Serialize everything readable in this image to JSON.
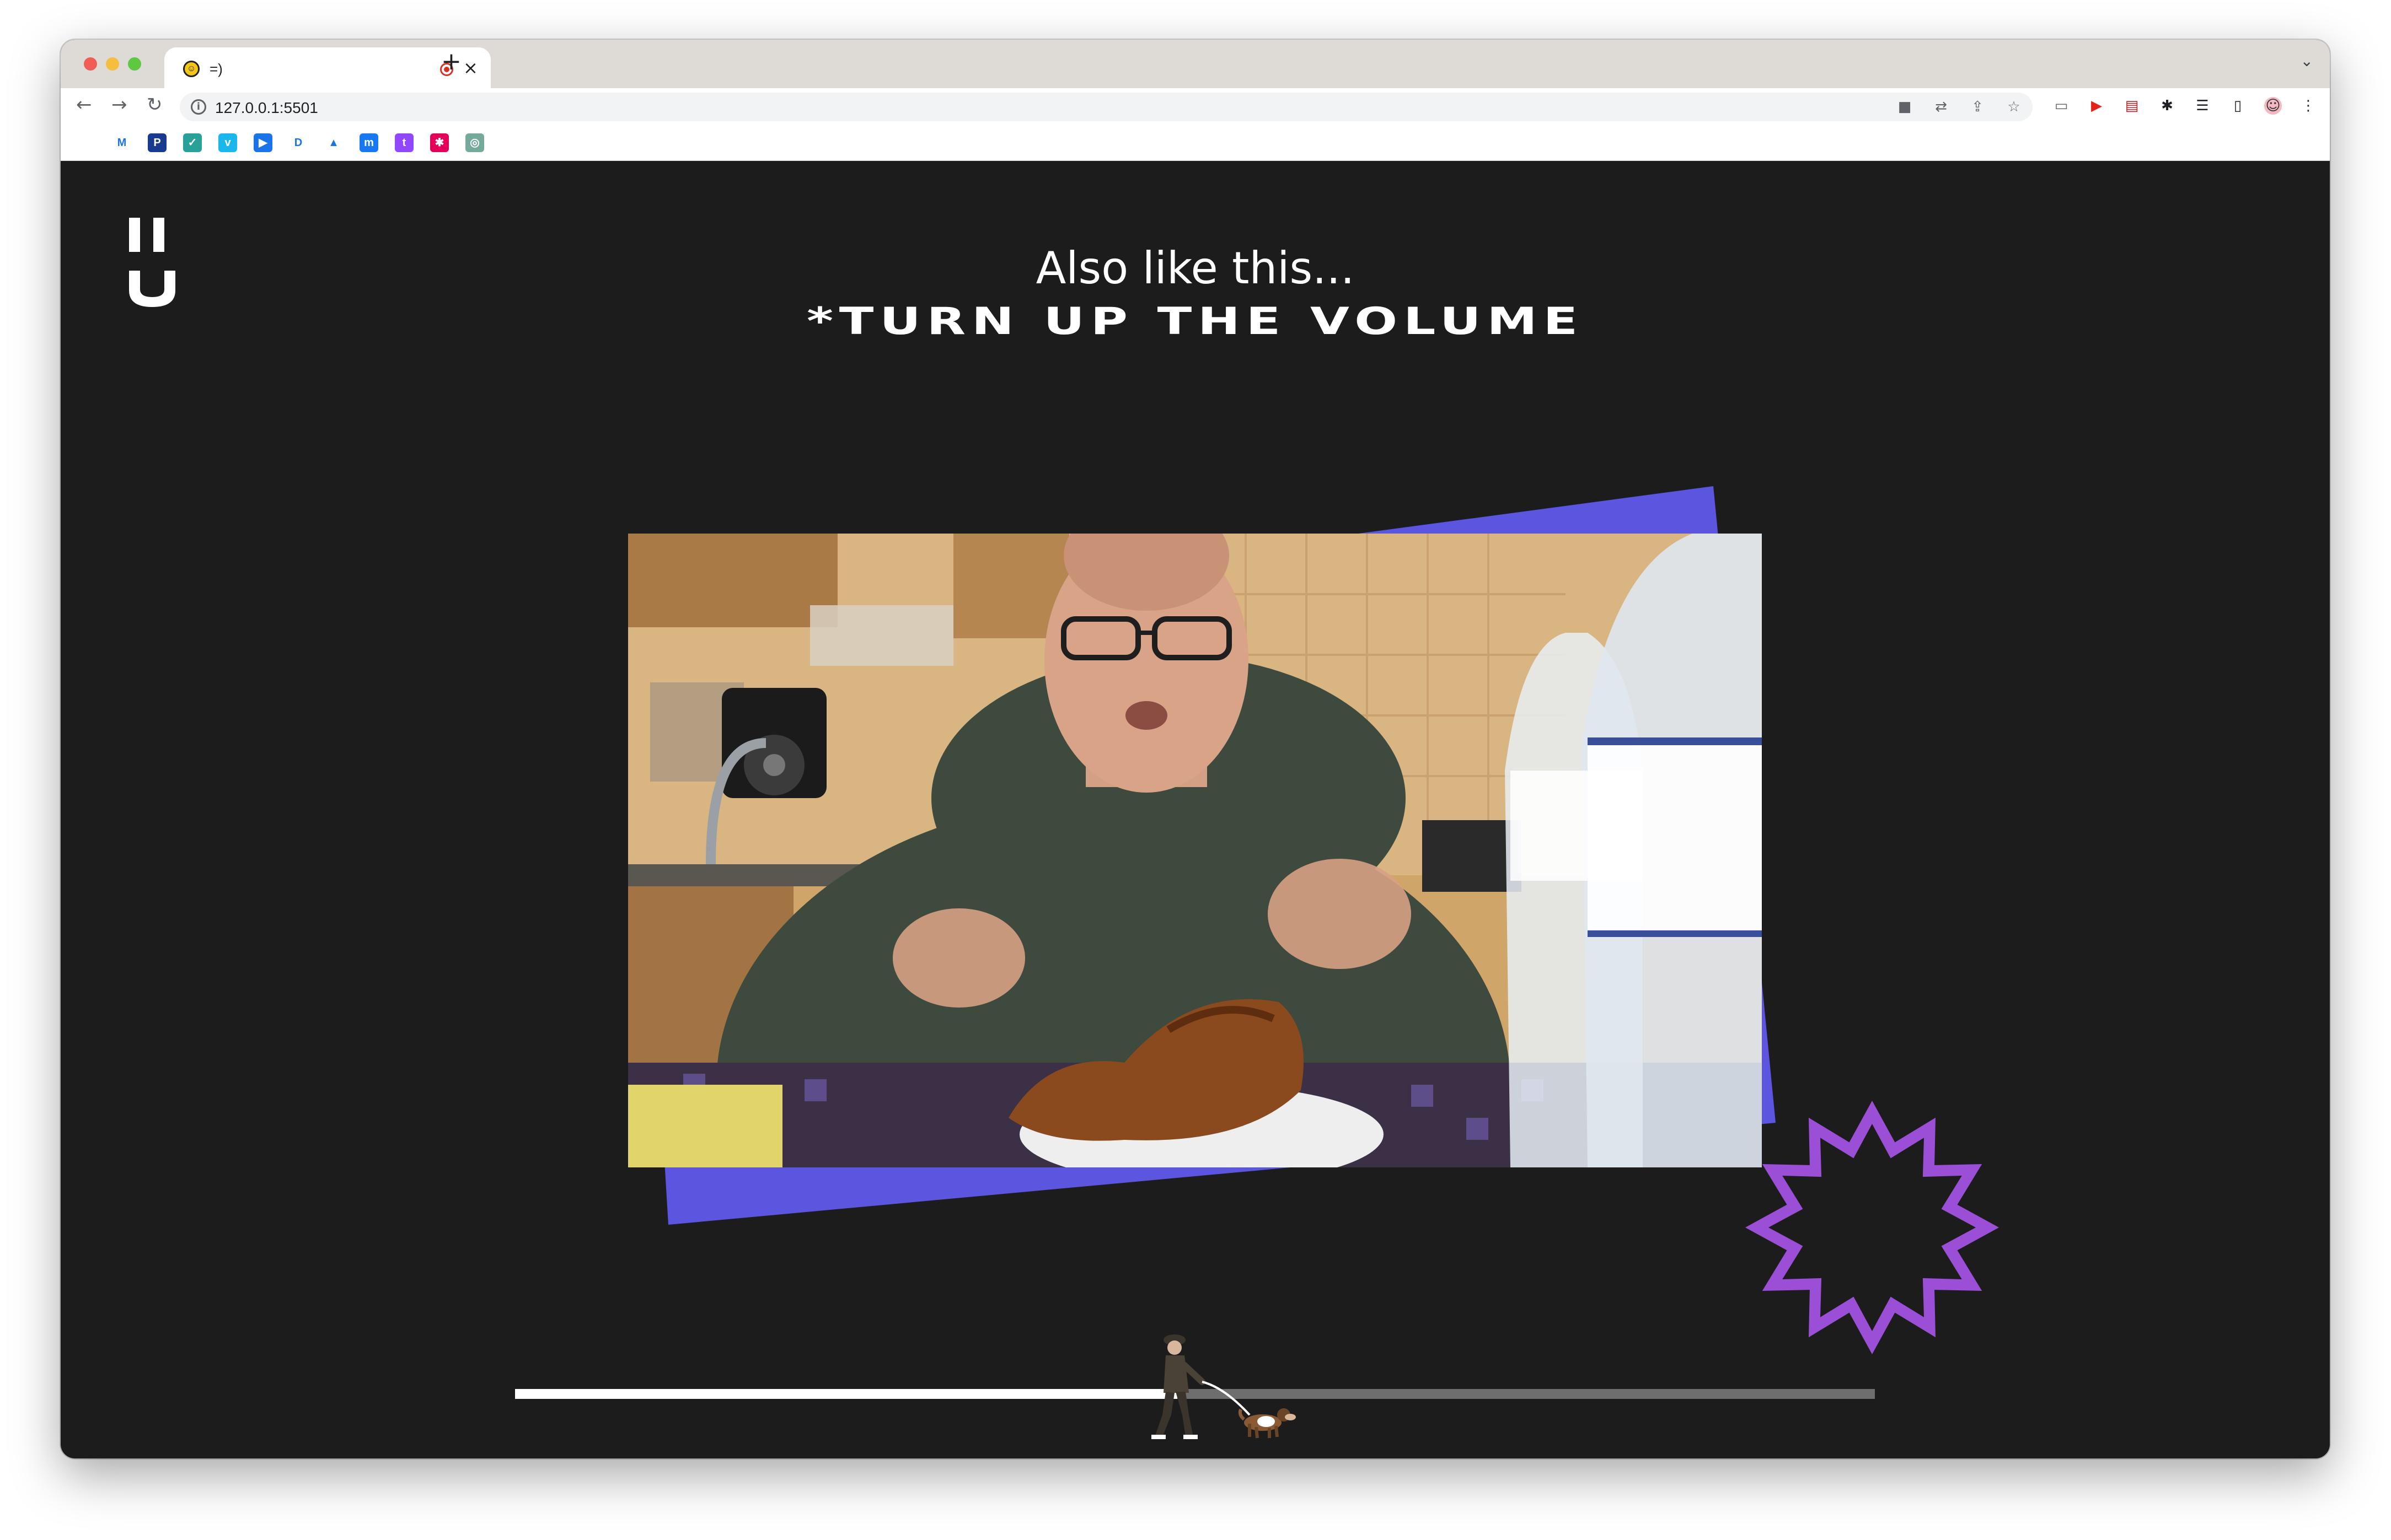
{
  "browser": {
    "tab": {
      "title": "=)",
      "favicon": "smiley-icon"
    },
    "url": "127.0.0.1:5501",
    "toolbar_icons": [
      "back-icon",
      "forward-icon",
      "reload-icon"
    ],
    "omnibox_icons": [
      "camera-icon",
      "translate-icon",
      "share-icon",
      "star-icon"
    ],
    "extension_icons": [
      "cast-icon",
      "youtube-icon",
      "pdf-icon",
      "puzzle-icon",
      "reading-list-icon",
      "sidepanel-icon",
      "profile-avatar",
      "more-icon"
    ],
    "bookmarks": [
      {
        "name": "history-icon",
        "color": "#ffffff",
        "glyph": ""
      },
      {
        "name": "gmail-icon",
        "color": "#ffffff",
        "glyph": "M"
      },
      {
        "name": "bookmark-p-icon",
        "color": "#1a3a8f",
        "glyph": "P"
      },
      {
        "name": "bookmark-check-icon",
        "color": "#2aa198",
        "glyph": "✓"
      },
      {
        "name": "vimeo-icon",
        "color": "#1ab7ea",
        "glyph": "v"
      },
      {
        "name": "play-icon",
        "color": "#1a73e8",
        "glyph": "▶"
      },
      {
        "name": "disney-icon",
        "color": "#ffffff",
        "glyph": "D"
      },
      {
        "name": "drive-icon",
        "color": "#ffffff",
        "glyph": "▲"
      },
      {
        "name": "messenger-icon",
        "color": "#1877f2",
        "glyph": "m"
      },
      {
        "name": "twitch-icon",
        "color": "#9146ff",
        "glyph": "t"
      },
      {
        "name": "bookmark-pink-icon",
        "color": "#e4005a",
        "glyph": "✱"
      },
      {
        "name": "bookmark-gpt-icon",
        "color": "#74aa9c",
        "glyph": "◎"
      }
    ]
  },
  "page": {
    "heading_line1": "Also like this...",
    "heading_line2": "*TURN UP THE VOLUME",
    "video": {
      "name": "video-player"
    },
    "progress": {
      "fraction": 0.487
    },
    "colors": {
      "background": "#1c1c1c",
      "accent_blue": "#5b55e0",
      "starburst": "#9b4fd6",
      "progress_fill": "#ffffff",
      "progress_track": "#6e6e6e"
    }
  }
}
